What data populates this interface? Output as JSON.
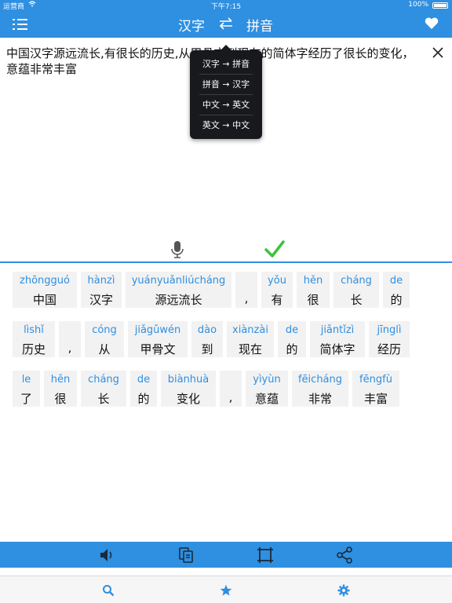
{
  "status_bar": {
    "carrier": "运营商",
    "time": "下午7:15",
    "battery": "100%"
  },
  "nav": {
    "from_language": "汉字",
    "to_language": "拼音"
  },
  "input": {
    "text": "中国汉字源远流长,有很长的历史,从甲骨文到现在的简体字经历了很长的变化，意蕴非常丰富"
  },
  "popover_options": [
    "汉字 → 拼音",
    "拼音 → 汉字",
    "中文 → 英文",
    "英文 → 中文"
  ],
  "result_rows": [
    [
      {
        "py": "zhōngguó",
        "hz": "中国"
      },
      {
        "py": "hànzì",
        "hz": "汉字"
      },
      {
        "py": "yuányuǎnliúcháng",
        "hz": "源远流长"
      },
      {
        "py": "",
        "hz": ","
      },
      {
        "py": "yǒu",
        "hz": "有"
      },
      {
        "py": "hěn",
        "hz": "很"
      },
      {
        "py": "cháng",
        "hz": "长"
      },
      {
        "py": "de",
        "hz": "的"
      }
    ],
    [
      {
        "py": "lìshǐ",
        "hz": "历史"
      },
      {
        "py": "",
        "hz": ","
      },
      {
        "py": "cóng",
        "hz": "从"
      },
      {
        "py": "jiǎgǔwén",
        "hz": "甲骨文"
      },
      {
        "py": "dào",
        "hz": "到"
      },
      {
        "py": "xiànzài",
        "hz": "现在"
      },
      {
        "py": "de",
        "hz": "的"
      },
      {
        "py": "jiǎntǐzì",
        "hz": "简体字"
      },
      {
        "py": "jīnglì",
        "hz": "经历"
      }
    ],
    [
      {
        "py": "le",
        "hz": "了"
      },
      {
        "py": "hěn",
        "hz": "很"
      },
      {
        "py": "cháng",
        "hz": "长"
      },
      {
        "py": "de",
        "hz": "的"
      },
      {
        "py": "biànhuà",
        "hz": "变化"
      },
      {
        "py": "",
        "hz": ","
      },
      {
        "py": "yìyùn",
        "hz": "意蕴"
      },
      {
        "py": "fēicháng",
        "hz": "非常"
      },
      {
        "py": "fēngfù",
        "hz": "丰富"
      }
    ]
  ],
  "toolbar_icons": [
    "speaker-icon",
    "copy-icon",
    "crop-icon",
    "share-icon"
  ],
  "tab_icons": [
    "search-icon",
    "star-icon",
    "gear-icon"
  ],
  "colors": {
    "accent": "#2f8fe0",
    "check": "#3cc43a",
    "popover": "#17191c",
    "cell_bg": "#f2f2f2"
  }
}
